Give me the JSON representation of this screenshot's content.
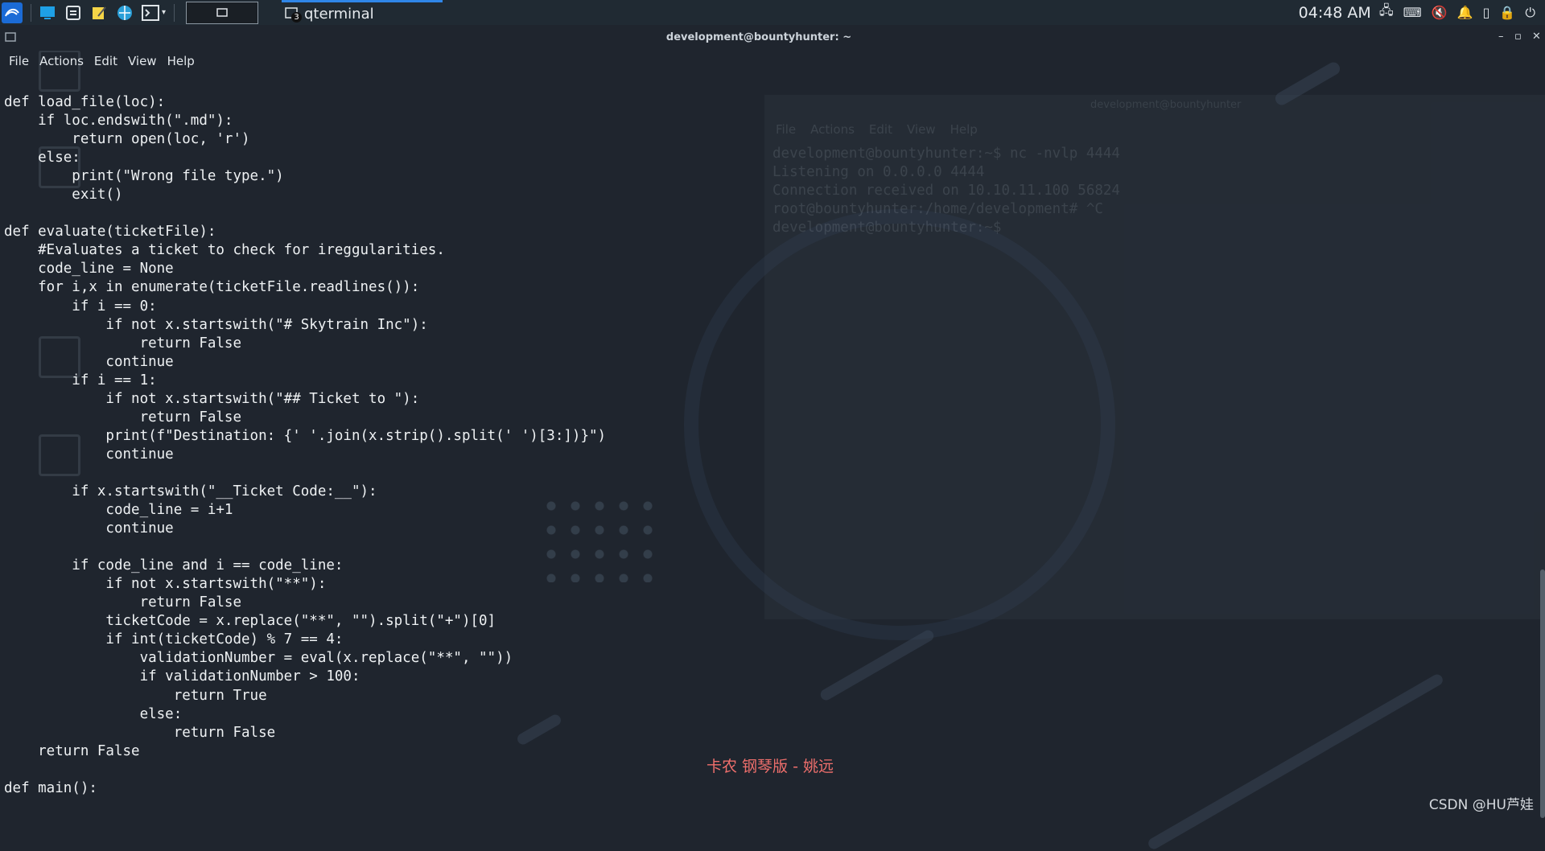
{
  "taskbar": {
    "task_label": "qterminal",
    "task_badge": "3",
    "clock": "04:48 AM"
  },
  "window": {
    "title": "development@bountyhunter: ~",
    "controls": [
      "–",
      "▫",
      "✕"
    ]
  },
  "menubar": [
    "File",
    "Actions",
    "Edit",
    "View",
    "Help"
  ],
  "code": "def load_file(loc):\n    if loc.endswith(\".md\"):\n        return open(loc, 'r')\n    else:\n        print(\"Wrong file type.\")\n        exit()\n\ndef evaluate(ticketFile):\n    #Evaluates a ticket to check for ireggularities.\n    code_line = None\n    for i,x in enumerate(ticketFile.readlines()):\n        if i == 0:\n            if not x.startswith(\"# Skytrain Inc\"):\n                return False\n            continue\n        if i == 1:\n            if not x.startswith(\"## Ticket to \"):\n                return False\n            print(f\"Destination: {' '.join(x.strip().split(' ')[3:])}\")\n            continue\n\n        if x.startswith(\"__Ticket Code:__\"):\n            code_line = i+1\n            continue\n\n        if code_line and i == code_line:\n            if not x.startswith(\"**\"):\n                return False\n            ticketCode = x.replace(\"**\", \"\").split(\"+\")[0]\n            if int(ticketCode) % 7 == 4:\n                validationNumber = eval(x.replace(\"**\", \"\"))\n                if validationNumber > 100:\n                    return True\n                else:\n                    return False\n    return False\n\ndef main():",
  "ghost_terminal": {
    "title": "development@bountyhunter",
    "menu": [
      "File",
      "Actions",
      "Edit",
      "View",
      "Help"
    ],
    "lines": "development@bountyhunter:~$ nc -nvlp 4444\nListening on 0.0.0.0 4444\nConnection received on 10.10.11.100 56824\nroot@bountyhunter:/home/development# ^C\ndevelopment@bountyhunter:~$ "
  },
  "overlay": {
    "lyric": "卡农 钢琴版 - 姚远",
    "watermark": "CSDN @HU芦娃"
  },
  "colors": {
    "accent": "#2f86e8",
    "background": "#1f252e",
    "lyric": "#ef6f6c"
  }
}
